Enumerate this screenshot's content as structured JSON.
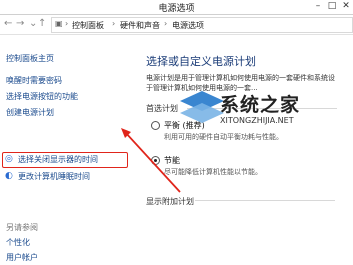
{
  "window": {
    "title": "电源选项"
  },
  "address": {
    "crumbs": [
      "控制面板",
      "硬件和声音",
      "电源选项"
    ]
  },
  "sidebar": {
    "home": "控制面板主页",
    "items": [
      "唤醒时需要密码",
      "选择电源按钮的功能",
      "创建电源计划",
      "选择关闭显示器的时间",
      "更改计算机睡眠时间"
    ],
    "see_also_title": "另请参阅",
    "see_also": [
      "个性化",
      "用户帐户"
    ]
  },
  "main": {
    "heading": "选择或自定义电源计划",
    "desc_line1": "电源计划是用于管理计算机如何使用电源的一套硬件和系统设",
    "desc_line2": "于管理计算机如何使用电源的一套...",
    "preferred_title": "首选计划",
    "plans": [
      {
        "name": "平衡 (推荐)",
        "desc": "利用可用的硬件自动平衡功耗与性能。",
        "selected": false
      },
      {
        "name": "节能",
        "desc": "尽可能降低计算机性能以节能。",
        "selected": true
      }
    ],
    "extra_title": "显示附加计划"
  },
  "watermark": {
    "text": "系统之家",
    "url": "XITONGZHIJIA.NET"
  },
  "colors": {
    "highlight": "#e0251b",
    "link": "#1a4a8d",
    "heading": "#1b3c78"
  }
}
